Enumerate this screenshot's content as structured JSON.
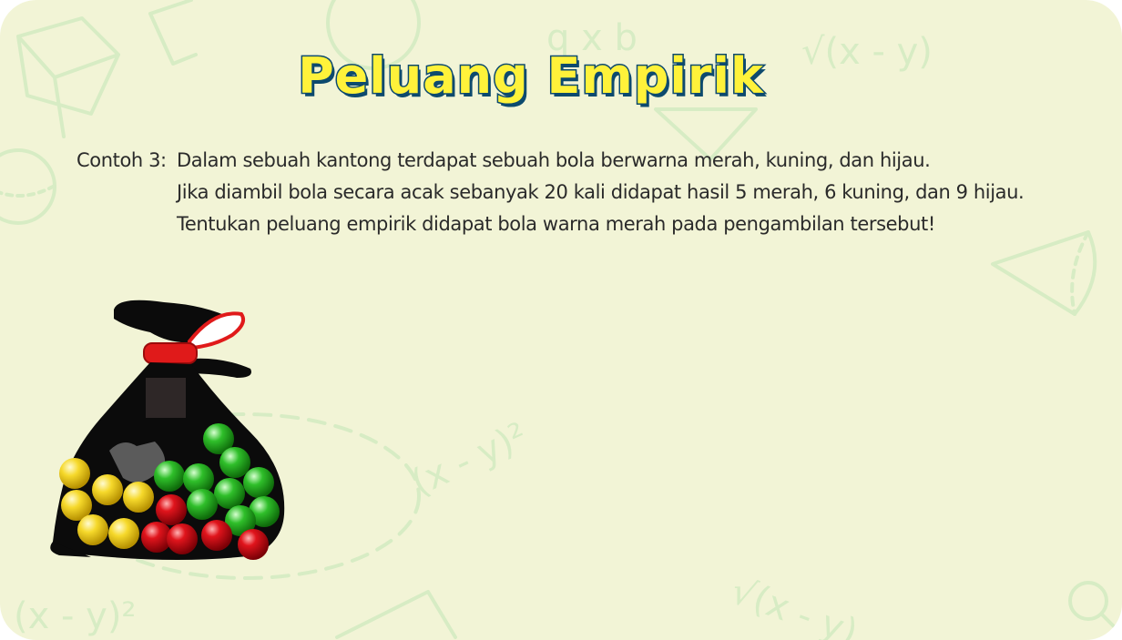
{
  "title": "Peluang Empirik",
  "problem": {
    "label": "Contoh 3:",
    "lines": [
      "Dalam sebuah kantong terdapat sebuah bola berwarna merah, kuning, dan hijau.",
      "Jika diambil bola secara acak sebanyak 20 kali didapat hasil 5 merah, 6  kuning, dan 9 hijau.",
      "Tentukan peluang empirik didapat bola warna merah pada pengambilan tersebut!"
    ]
  },
  "background_doodles": [
    "q x b",
    "√(x - y)",
    "(x - y)²",
    "(x - y)²",
    "√(x - y)"
  ],
  "colors": {
    "background": "#f2f4d6",
    "doodle": "#d7ecc4",
    "title_fill": "#fff23a",
    "title_outline": "#0d4a6e",
    "ball_red": "#d4141c",
    "ball_yellow": "#f6d92b",
    "ball_green": "#2fbf2a",
    "bag": "#0b0b0b"
  }
}
